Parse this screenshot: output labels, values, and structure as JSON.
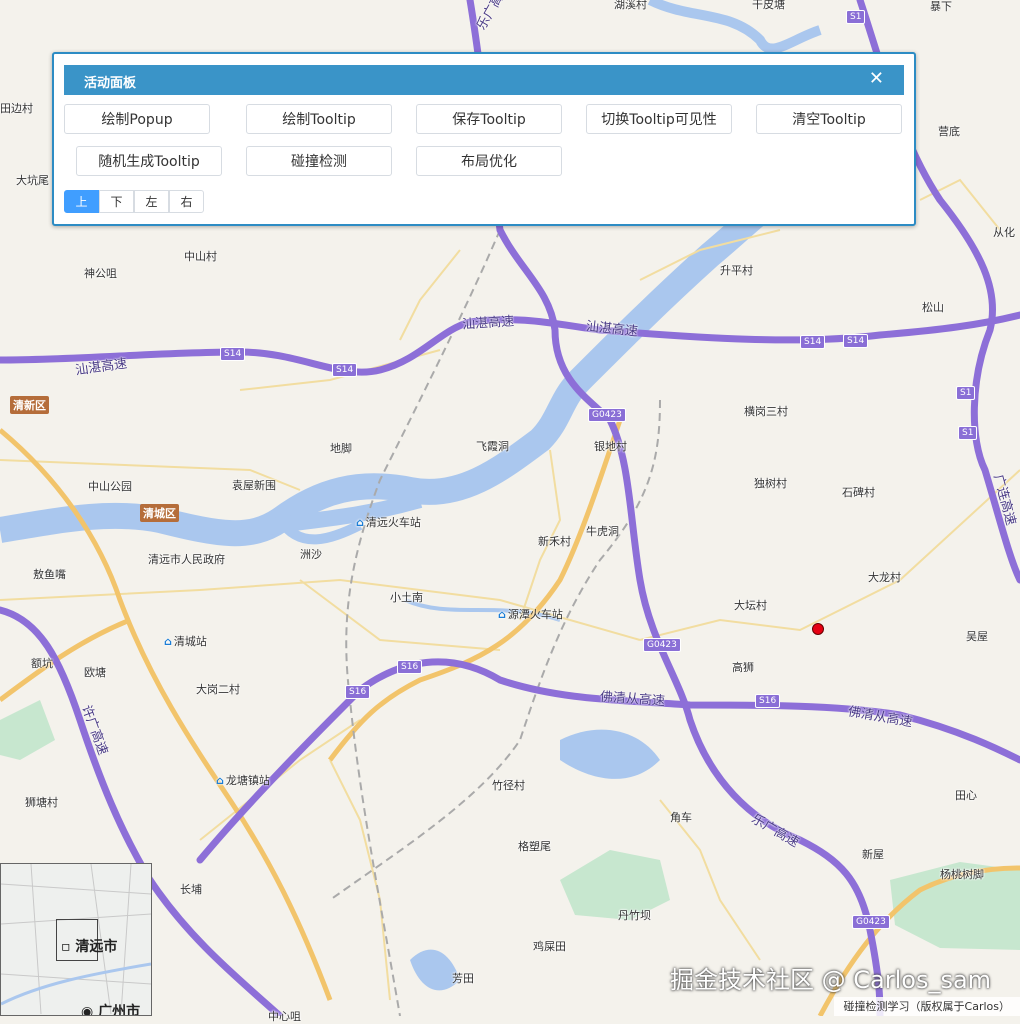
{
  "panel": {
    "title": "活动面板",
    "close": "✕",
    "buttons": [
      "绘制Popup",
      "绘制Tooltip",
      "保存Tooltip",
      "切换Tooltip可见性",
      "清空Tooltip",
      "随机生成Tooltip",
      "碰撞检测",
      "布局优化"
    ],
    "directions": [
      "上",
      "下",
      "左",
      "右"
    ],
    "active_direction": "上"
  },
  "map": {
    "places": [
      "湖溪村",
      "干皮塘",
      "暴下",
      "田边村",
      "营底",
      "大坑尾",
      "从化",
      "神公咀",
      "中山村",
      "升平村",
      "松山",
      "横岗三村",
      "地脚",
      "飞霞洞",
      "银地村",
      "独树村",
      "石碑村",
      "中山公园",
      "袁屋新围",
      "新禾村",
      "牛虎洞",
      "清远市人民政府",
      "洲沙",
      "敖鱼嘴",
      "大龙村",
      "小土南",
      "大坛村",
      "吴屋",
      "额坑",
      "欧塘",
      "高狮",
      "大岗二村",
      "狮塘村",
      "竹径村",
      "田心",
      "角车",
      "格塑尾",
      "新屋",
      "杨桃树脚",
      "长埔",
      "丹竹坝",
      "鸡屎田",
      "芳田",
      "中心咀"
    ],
    "districts": [
      "清新区",
      "清城区"
    ],
    "stations": [
      "清远火车站",
      "源潭火车站",
      "清城站",
      "龙塘镇站"
    ],
    "roads": [
      "汕湛高速",
      "汕湛高速",
      "汕湛高速",
      "佛清从高速",
      "佛清从高速",
      "乐广高速",
      "许广高速",
      "广连高速",
      "乐广高速"
    ],
    "shields": [
      "S1",
      "S14",
      "S14",
      "S14",
      "S14",
      "S1",
      "S1",
      "G0423",
      "G0423",
      "S16",
      "S16",
      "S16",
      "G0423"
    ],
    "colors": {
      "highway": "#a98fe8",
      "river": "#aac7ee",
      "major_road": "#f2c46b",
      "marker": "#e60012"
    }
  },
  "overview": {
    "city1": "清远市",
    "city2": "广州市"
  },
  "watermark": "掘金技术社区 @ Carlos_sam",
  "attribution": "碰撞检测学习（版权属于Carlos）"
}
